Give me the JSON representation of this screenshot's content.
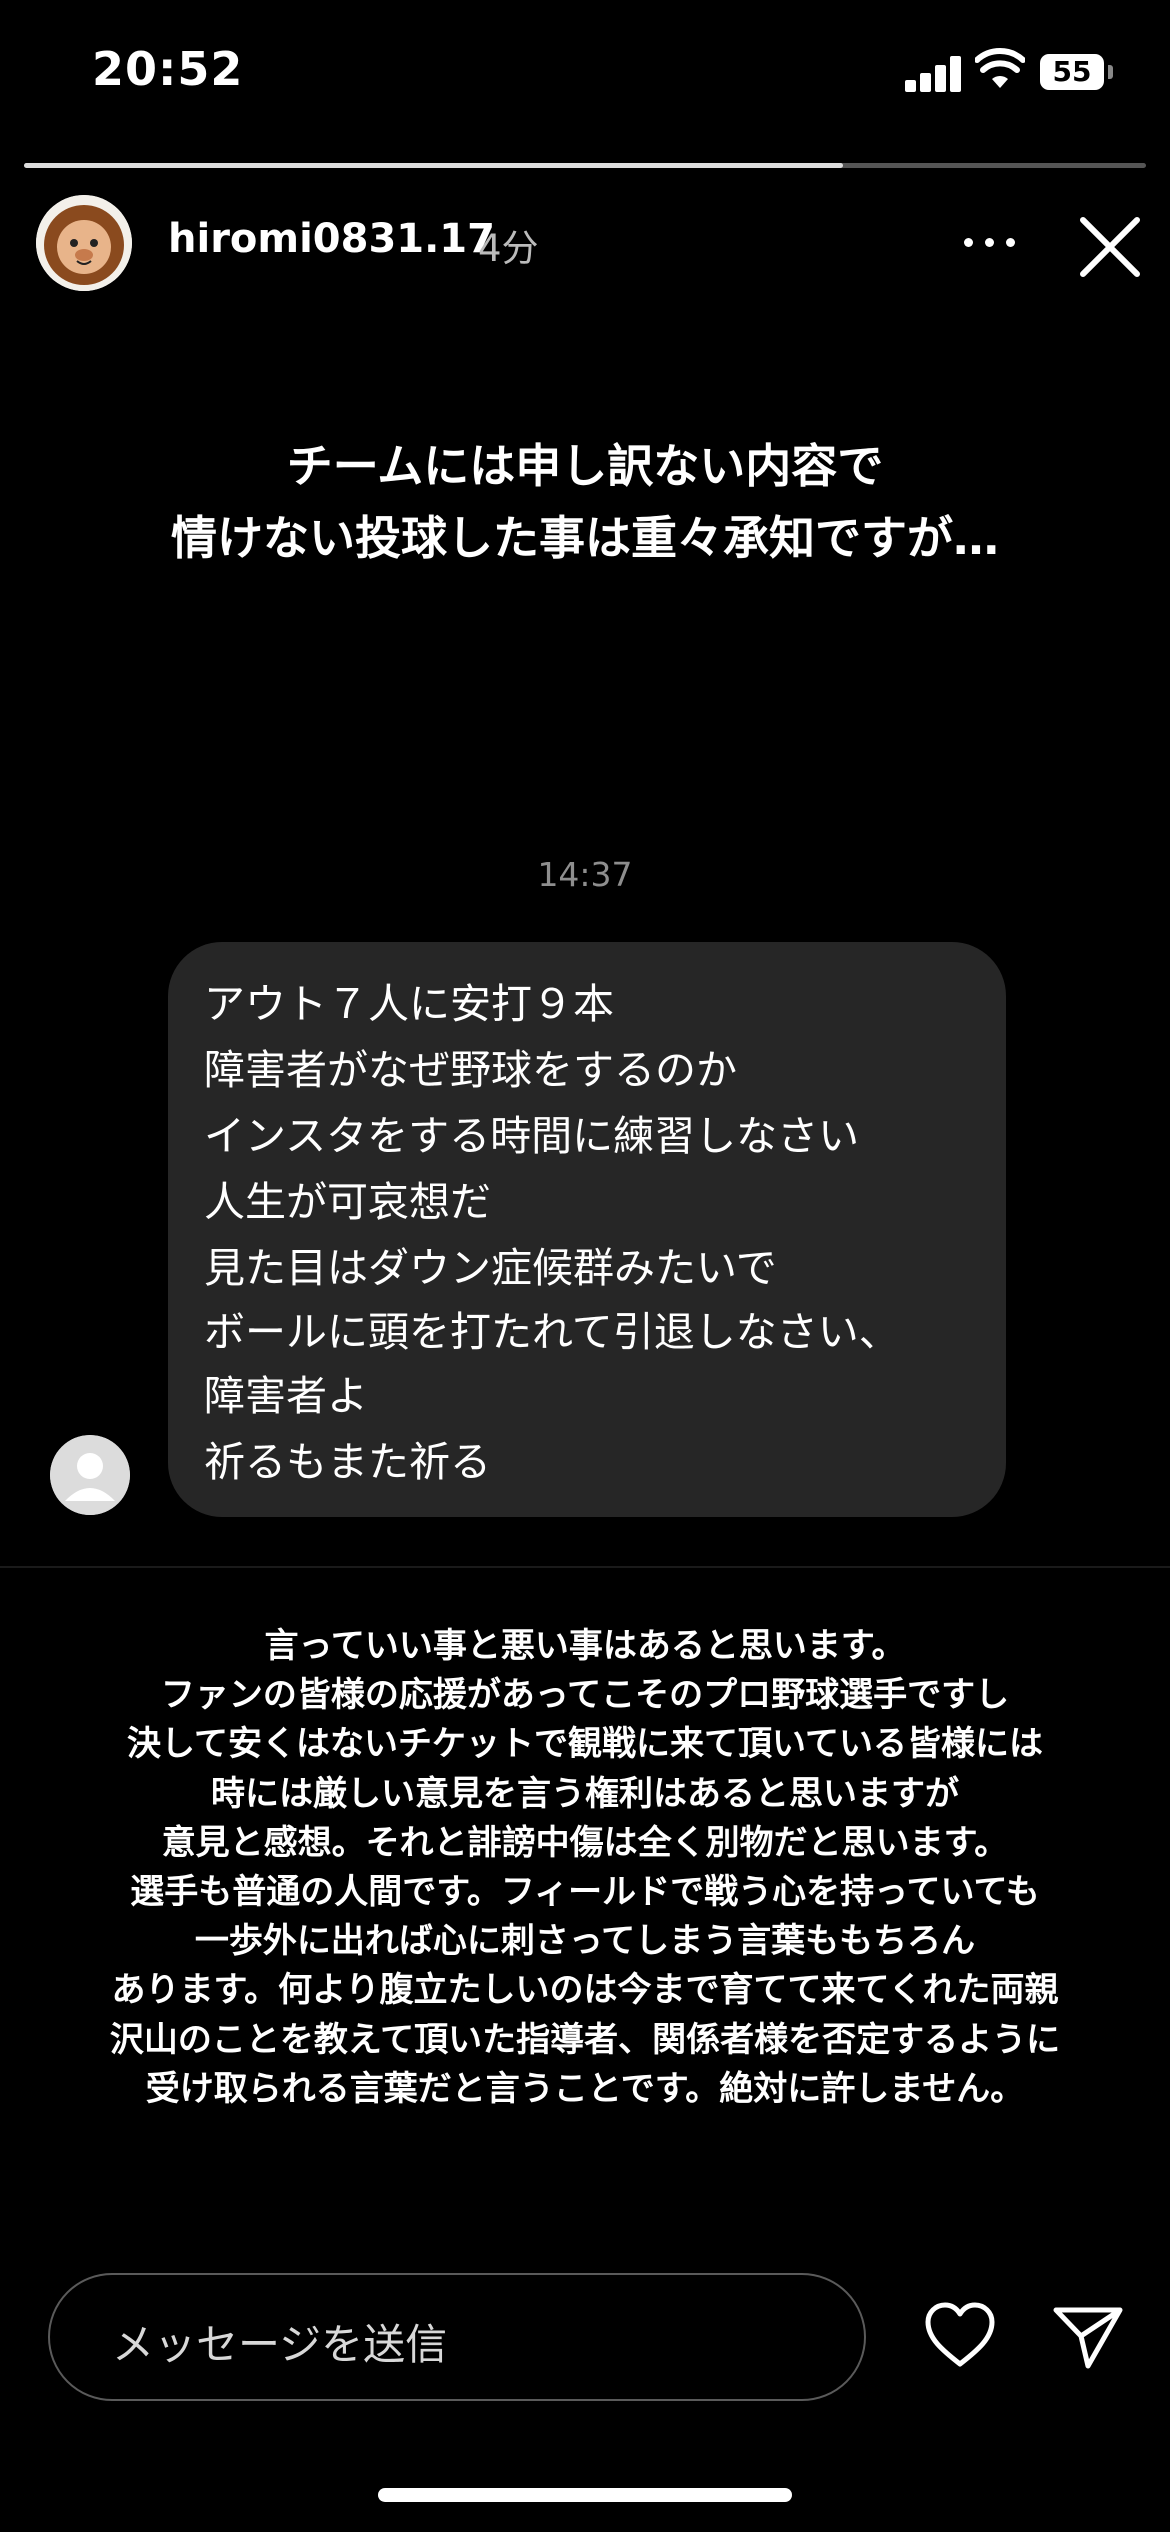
{
  "status_bar": {
    "time": "20:52",
    "battery": "55"
  },
  "story": {
    "progress": 0.73,
    "username": "hiromi0831.17",
    "time_ago": "4分"
  },
  "headline": {
    "lines": [
      "チームには申し訳ない内容で",
      "情けない投球した事は重々承知ですが…"
    ]
  },
  "dm": {
    "timestamp": "14:37",
    "lines": [
      "アウト７人に安打９本",
      "障害者がなぜ野球をするのか",
      "インスタをする時間に練習しなさい",
      "人生が可哀想だ",
      "見た目はダウン症候群みたいで",
      "ボールに頭を打たれて引退しなさい、",
      "障害者よ",
      "祈るもまた祈る"
    ]
  },
  "statement": {
    "lines": [
      "言っていい事と悪い事はあると思います。",
      "ファンの皆様の応援があってこそのプロ野球選手ですし",
      "決して安くはないチケットで観戦に来て頂いている皆様には",
      "時には厳しい意見を言う権利はあると思いますが",
      "意見と感想。それと誹謗中傷は全く別物だと思います。",
      "選手も普通の人間です。フィールドで戦う心を持っていても",
      "一歩外に出れば心に刺さってしまう言葉ももちろん",
      "あります。何より腹立たしいのは今まで育てて来てくれた両親",
      "沢山のことを教えて頂いた指導者、関係者様を否定するように",
      "受け取られる言葉だと言うことです。絶対に許しません。"
    ]
  },
  "reply": {
    "placeholder": "メッセージを送信"
  },
  "icons": {
    "more": "more-horizontal-icon",
    "close": "close-icon",
    "like": "heart-icon",
    "send": "send-icon"
  }
}
